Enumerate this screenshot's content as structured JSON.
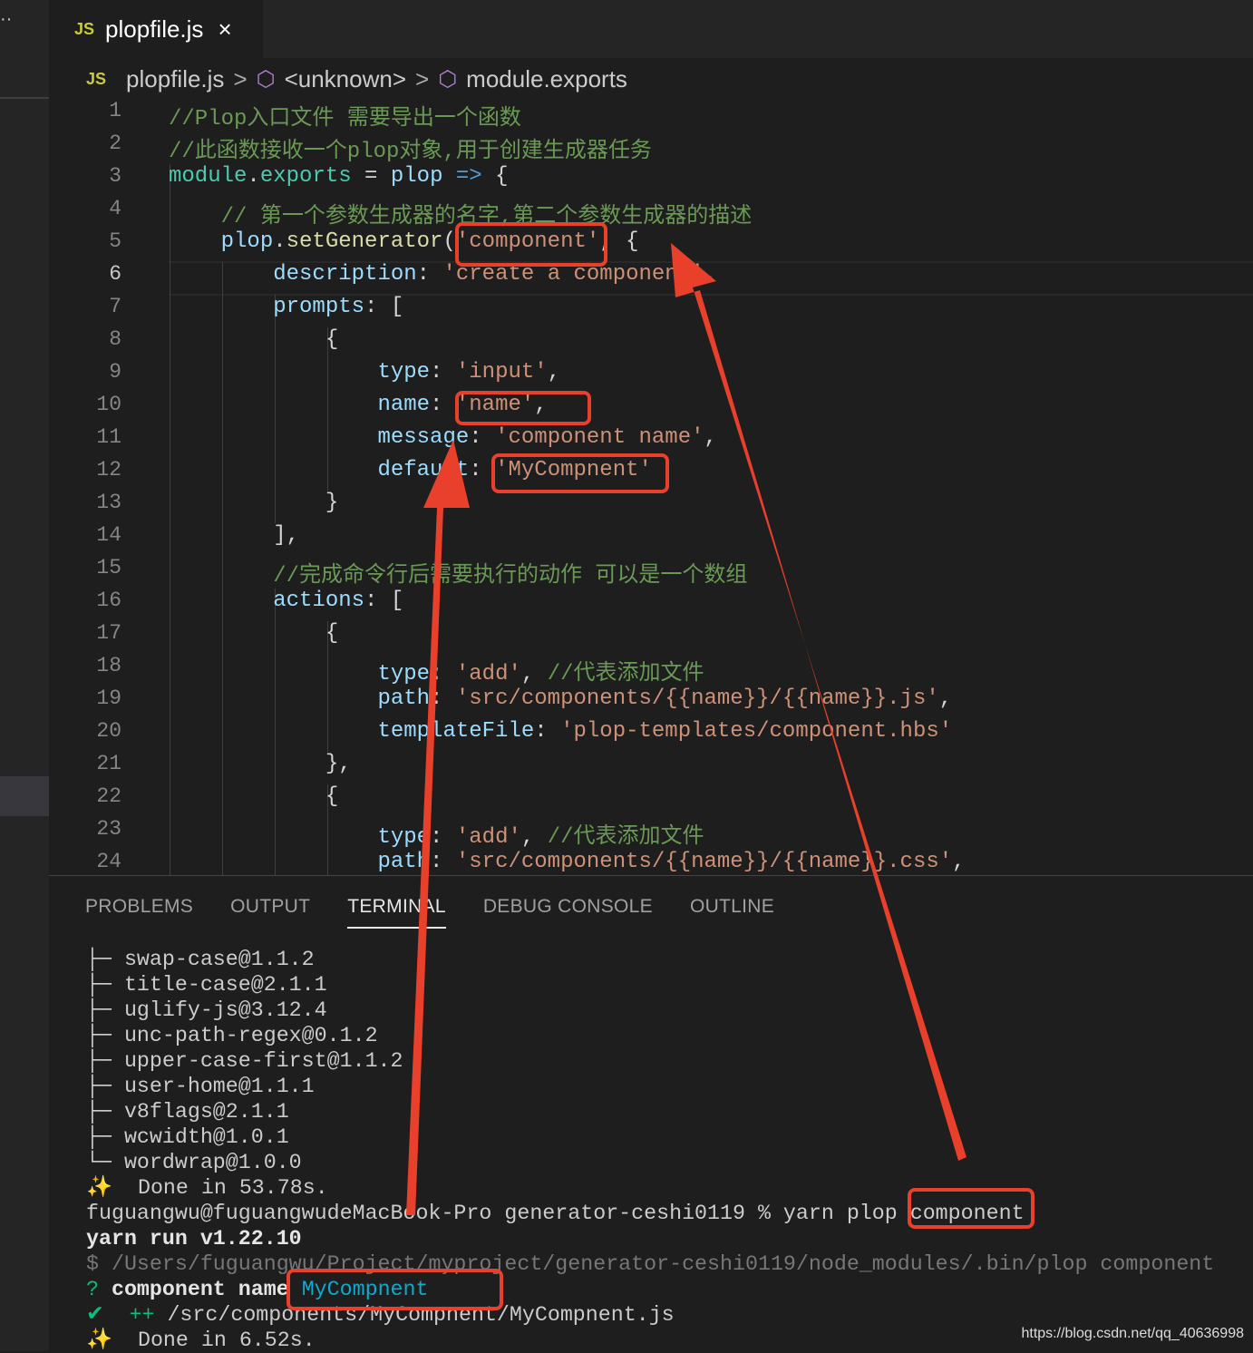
{
  "tab": {
    "icon": "JS",
    "title": "plopfile.js",
    "close": "×"
  },
  "breadcrumb": {
    "file": "plopfile.js",
    "sep": ">",
    "item1": "<unknown>",
    "item2": "module.exports",
    "icon": "JS"
  },
  "active_line": 6,
  "code": [
    [
      [
        "//Plop入口文件 需要导出一个函数",
        "c"
      ]
    ],
    [
      [
        "//此函数接收一个plop对象,用于创建生成器任务",
        "c"
      ]
    ],
    [
      [
        "module",
        "t"
      ],
      [
        ".",
        "p"
      ],
      [
        "exports",
        "t"
      ],
      [
        " = ",
        "p"
      ],
      [
        "plop",
        "v"
      ],
      [
        " => ",
        "k"
      ],
      [
        "{",
        "p"
      ]
    ],
    [
      [
        "    // 第一个参数生成器的名字,第二个参数生成器的描述",
        "c"
      ]
    ],
    [
      [
        "    ",
        "p"
      ],
      [
        "plop",
        "v"
      ],
      [
        ".",
        "p"
      ],
      [
        "setGenerator",
        "f"
      ],
      [
        "(",
        "p"
      ],
      [
        "'component'",
        "s"
      ],
      [
        ", {",
        "p"
      ]
    ],
    [
      [
        "        ",
        "p"
      ],
      [
        "description",
        "v"
      ],
      [
        ": ",
        "p"
      ],
      [
        "'create a component'",
        "s"
      ],
      [
        ",",
        "p"
      ]
    ],
    [
      [
        "        ",
        "p"
      ],
      [
        "prompts",
        "v"
      ],
      [
        ": [",
        "p"
      ]
    ],
    [
      [
        "            {",
        "p"
      ]
    ],
    [
      [
        "                ",
        "p"
      ],
      [
        "type",
        "v"
      ],
      [
        ": ",
        "p"
      ],
      [
        "'input'",
        "s"
      ],
      [
        ",",
        "p"
      ]
    ],
    [
      [
        "                ",
        "p"
      ],
      [
        "name",
        "v"
      ],
      [
        ": ",
        "p"
      ],
      [
        "'name'",
        "s"
      ],
      [
        ",",
        "p"
      ]
    ],
    [
      [
        "                ",
        "p"
      ],
      [
        "message",
        "v"
      ],
      [
        ": ",
        "p"
      ],
      [
        "'component name'",
        "s"
      ],
      [
        ",",
        "p"
      ]
    ],
    [
      [
        "                ",
        "p"
      ],
      [
        "default",
        "v"
      ],
      [
        ": ",
        "p"
      ],
      [
        "'MyCompnent'",
        "s"
      ]
    ],
    [
      [
        "            }",
        "p"
      ]
    ],
    [
      [
        "        ],",
        "p"
      ]
    ],
    [
      [
        "        //完成命令行后需要执行的动作 可以是一个数组",
        "c"
      ]
    ],
    [
      [
        "        ",
        "p"
      ],
      [
        "actions",
        "v"
      ],
      [
        ": [",
        "p"
      ]
    ],
    [
      [
        "            {",
        "p"
      ]
    ],
    [
      [
        "                ",
        "p"
      ],
      [
        "type",
        "v"
      ],
      [
        ": ",
        "p"
      ],
      [
        "'add'",
        "s"
      ],
      [
        ", ",
        "p"
      ],
      [
        "//代表添加文件",
        "c"
      ]
    ],
    [
      [
        "                ",
        "p"
      ],
      [
        "path",
        "v"
      ],
      [
        ": ",
        "p"
      ],
      [
        "'src/components/{{name}}/{{name}}.js'",
        "s"
      ],
      [
        ",",
        "p"
      ]
    ],
    [
      [
        "                ",
        "p"
      ],
      [
        "templateFile",
        "v"
      ],
      [
        ": ",
        "p"
      ],
      [
        "'plop-templates/component.hbs'",
        "s"
      ]
    ],
    [
      [
        "            },",
        "p"
      ]
    ],
    [
      [
        "            {",
        "p"
      ]
    ],
    [
      [
        "                ",
        "p"
      ],
      [
        "type",
        "v"
      ],
      [
        ": ",
        "p"
      ],
      [
        "'add'",
        "s"
      ],
      [
        ", ",
        "p"
      ],
      [
        "//代表添加文件",
        "c"
      ]
    ],
    [
      [
        "                ",
        "p"
      ],
      [
        "path",
        "v"
      ],
      [
        ": ",
        "p"
      ],
      [
        "'src/components/{{name}}/{{name}}.css'",
        "s"
      ],
      [
        ",",
        "p"
      ]
    ]
  ],
  "panel": {
    "tabs": [
      "PROBLEMS",
      "OUTPUT",
      "TERMINAL",
      "DEBUG CONSOLE",
      "OUTLINE"
    ],
    "active": "TERMINAL"
  },
  "terminal": [
    [
      [
        "├─ swap-case@1.1.2",
        ""
      ]
    ],
    [
      [
        "├─ title-case@2.1.1",
        ""
      ]
    ],
    [
      [
        "├─ uglify-js@3.12.4",
        ""
      ]
    ],
    [
      [
        "├─ unc-path-regex@0.1.2",
        ""
      ]
    ],
    [
      [
        "├─ upper-case-first@1.1.2",
        ""
      ]
    ],
    [
      [
        "├─ user-home@1.1.1",
        ""
      ]
    ],
    [
      [
        "├─ v8flags@2.1.1",
        ""
      ]
    ],
    [
      [
        "├─ wcwidth@1.0.1",
        ""
      ]
    ],
    [
      [
        "└─ wordwrap@1.0.0",
        ""
      ]
    ],
    [
      [
        "✨",
        "yl"
      ],
      [
        "  Done in 53.78s.",
        ""
      ]
    ],
    [
      [
        "fuguangwu@fuguangwudeMacBook-Pro generator-ceshi0119 % yarn plop component",
        ""
      ]
    ],
    [
      [
        "yarn run v1.22.10",
        "b"
      ]
    ],
    [
      [
        "$ /Users/fuguangwu/Project/myproject/generator-ceshi0119/node_modules/.bin/plop component",
        "g"
      ]
    ],
    [
      [
        "? ",
        "gr"
      ],
      [
        "component name ",
        "b"
      ],
      [
        "MyCompnent",
        "cy"
      ]
    ],
    [
      [
        "✔",
        "gr"
      ],
      [
        "  ++ ",
        "gr"
      ],
      [
        "/src/components/MyCompnent/MyCompnent.js",
        ""
      ]
    ],
    [
      [
        "✨",
        "yl"
      ],
      [
        "  Done in 6.52s.",
        ""
      ]
    ]
  ],
  "watermark": "https://blog.csdn.net/qq_40636998",
  "annotation_color": "#e8402a"
}
